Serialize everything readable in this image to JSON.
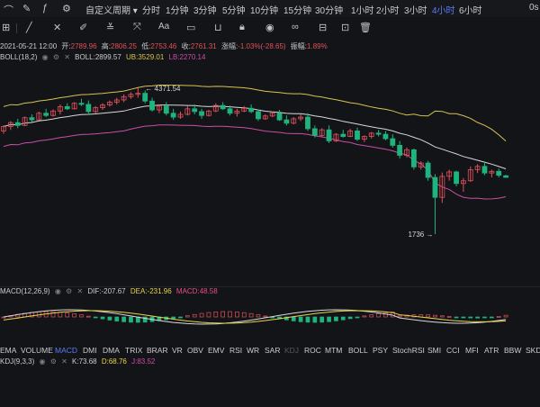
{
  "toolbar": {
    "intervals": [
      {
        "label": "自定义周期",
        "active": false,
        "dropdown": true
      },
      {
        "label": "分时",
        "active": false
      },
      {
        "label": "1分钟",
        "active": false
      },
      {
        "label": "3分钟",
        "active": false
      },
      {
        "label": "5分钟",
        "active": false
      },
      {
        "label": "10分钟",
        "active": false
      },
      {
        "label": "15分钟",
        "active": false
      },
      {
        "label": "30分钟",
        "active": false
      },
      {
        "label": "1小时",
        "active": false
      },
      {
        "label": "2小时",
        "active": false
      },
      {
        "label": "3小时",
        "active": false
      },
      {
        "label": "4小时",
        "active": true
      },
      {
        "label": "6小时",
        "active": false
      }
    ],
    "right_label": "0s"
  },
  "drawing_tools": [
    "fib-icon",
    "line-icon",
    "cross-icon",
    "underline-icon",
    "measure-icon",
    "close-brush-icon",
    "font-size-icon",
    "ruler-icon",
    "magnet-icon",
    "lock-icon",
    "eye-icon",
    "lock-icon-2",
    "trash-icon"
  ],
  "ohlc": {
    "date": "2021-05-21 12:00",
    "open_label": "开:",
    "open": "2789.96",
    "high_label": "高:",
    "high": "2806.25",
    "low_label": "低:",
    "low": "2753.46",
    "close_label": "收:",
    "close": "2761.31",
    "change_label": "涨幅:",
    "change": "-1.03%(-28.65)",
    "amp_label": "振幅:",
    "amp": "1.89%"
  },
  "boll": {
    "name": "BOLL(18,2)",
    "mid_label": "BOLL:",
    "mid": "2899.57",
    "ub_label": "UB:",
    "ub": "3529.01",
    "lb_label": "LB:",
    "lb": "2270.14"
  },
  "macd": {
    "name": "MACD(12,26,9)",
    "dif_label": "DIF:",
    "dif": "-207.67",
    "dea_label": "DEA:",
    "dea": "-231.96",
    "macd_label": "MACD:",
    "macd": "48.58"
  },
  "kdj": {
    "name": "KDJ(9,3,3)",
    "k_label": "K:",
    "k": "73.68",
    "d_label": "D:",
    "d": "68.76",
    "j_label": "J:",
    "j": "83.52"
  },
  "annotations": {
    "high": "4371.54",
    "low": "1736"
  },
  "indicators": [
    {
      "label": "EMA",
      "active": false
    },
    {
      "label": "VOLUME",
      "active": false
    },
    {
      "label": "MACD",
      "active": true
    },
    {
      "label": "DMI",
      "active": false
    },
    {
      "label": "DMA",
      "active": false
    },
    {
      "label": "TRIX",
      "active": false
    },
    {
      "label": "BRAR",
      "active": false
    },
    {
      "label": "VR",
      "active": false
    },
    {
      "label": "OBV",
      "active": false
    },
    {
      "label": "EMV",
      "active": false
    },
    {
      "label": "RSI",
      "active": false
    },
    {
      "label": "WR",
      "active": false
    },
    {
      "label": "SAR",
      "active": false
    },
    {
      "label": "KDJ",
      "active": false,
      "dim": true
    },
    {
      "label": "ROC",
      "active": false
    },
    {
      "label": "MTM",
      "active": false
    },
    {
      "label": "BOLL",
      "active": false
    },
    {
      "label": "PSY",
      "active": false
    },
    {
      "label": "StochRSI",
      "active": false
    },
    {
      "label": "SMI",
      "active": false
    },
    {
      "label": "CCI",
      "active": false
    },
    {
      "label": "MFI",
      "active": false
    },
    {
      "label": "ATR",
      "active": false
    },
    {
      "label": "BBW",
      "active": false
    },
    {
      "label": "SKD",
      "active": false
    }
  ],
  "colors": {
    "up": "#e0525c",
    "down": "#1fb47d",
    "boll_mid": "#d8d8d8",
    "boll_ub": "#d8c250",
    "boll_lb": "#c84fa6",
    "active": "#5b7cf6",
    "dea": "#e8d44d",
    "macd": "#e74e8a",
    "j": "#c84fa6"
  },
  "chart_data": {
    "type": "candlestick",
    "interval": "4小时",
    "candles": [
      [
        3600,
        3700,
        3550,
        3680
      ],
      [
        3680,
        3780,
        3620,
        3750
      ],
      [
        3750,
        3820,
        3650,
        3700
      ],
      [
        3700,
        3860,
        3690,
        3840
      ],
      [
        3840,
        3900,
        3760,
        3800
      ],
      [
        3800,
        3950,
        3790,
        3920
      ],
      [
        3920,
        4000,
        3850,
        3880
      ],
      [
        3880,
        3990,
        3860,
        3960
      ],
      [
        3960,
        4080,
        3900,
        4040
      ],
      [
        4040,
        4100,
        3980,
        4000
      ],
      [
        4000,
        4120,
        3990,
        4100
      ],
      [
        4100,
        4180,
        4050,
        4080
      ],
      [
        4080,
        4150,
        3900,
        3950
      ],
      [
        3950,
        4050,
        3920,
        4020
      ],
      [
        4020,
        4100,
        3980,
        4070
      ],
      [
        4070,
        4150,
        4040,
        4120
      ],
      [
        4120,
        4200,
        4080,
        4160
      ],
      [
        4160,
        4260,
        4120,
        4220
      ],
      [
        4220,
        4300,
        4180,
        4260
      ],
      [
        4260,
        4371.54,
        4200,
        4280
      ],
      [
        4280,
        4330,
        4100,
        4140
      ],
      [
        4140,
        4200,
        3950,
        3980
      ],
      [
        3980,
        4080,
        3920,
        4050
      ],
      [
        4050,
        4120,
        3880,
        3920
      ],
      [
        3920,
        4000,
        3800,
        3850
      ],
      [
        3850,
        3950,
        3820,
        3900
      ],
      [
        3900,
        4050,
        3880,
        4000
      ],
      [
        4000,
        4080,
        3900,
        3950
      ],
      [
        3950,
        4000,
        3820,
        3880
      ],
      [
        3880,
        3980,
        3860,
        3960
      ],
      [
        3960,
        4100,
        3940,
        4060
      ],
      [
        4060,
        4120,
        3980,
        4000
      ],
      [
        4000,
        4060,
        3880,
        3920
      ],
      [
        3920,
        4000,
        3860,
        3960
      ],
      [
        3960,
        4050,
        3940,
        4010
      ],
      [
        4010,
        4080,
        3920,
        3950
      ],
      [
        3950,
        3990,
        3780,
        3820
      ],
      [
        3820,
        3900,
        3800,
        3870
      ],
      [
        3870,
        3950,
        3850,
        3920
      ],
      [
        3920,
        3980,
        3780,
        3800
      ],
      [
        3800,
        3880,
        3700,
        3740
      ],
      [
        3740,
        3850,
        3720,
        3820
      ],
      [
        3820,
        3900,
        3780,
        3850
      ],
      [
        3850,
        3920,
        3600,
        3640
      ],
      [
        3640,
        3700,
        3480,
        3520
      ],
      [
        3520,
        3650,
        3500,
        3620
      ],
      [
        3620,
        3700,
        3380,
        3420
      ],
      [
        3420,
        3560,
        3400,
        3540
      ],
      [
        3540,
        3620,
        3480,
        3500
      ],
      [
        3500,
        3640,
        3490,
        3600
      ],
      [
        3600,
        3660,
        3420,
        3450
      ],
      [
        3450,
        3520,
        3400,
        3500
      ],
      [
        3500,
        3580,
        3460,
        3560
      ],
      [
        3560,
        3620,
        3500,
        3540
      ],
      [
        3540,
        3600,
        3430,
        3460
      ],
      [
        3460,
        3540,
        3300,
        3340
      ],
      [
        3340,
        3420,
        3100,
        3160
      ],
      [
        3160,
        3300,
        3120,
        3260
      ],
      [
        3260,
        3280,
        2900,
        2950
      ],
      [
        2950,
        3050,
        2900,
        3020
      ],
      [
        3020,
        3060,
        2700,
        2760
      ],
      [
        2760,
        2820,
        1736,
        2400
      ],
      [
        2400,
        2850,
        2300,
        2780
      ],
      [
        2780,
        2900,
        2700,
        2860
      ],
      [
        2860,
        2880,
        2600,
        2650
      ],
      [
        2650,
        2750,
        2500,
        2700
      ],
      [
        2700,
        2960,
        2680,
        2900
      ],
      [
        2900,
        3000,
        2840,
        2960
      ],
      [
        2960,
        3050,
        2800,
        2840
      ],
      [
        2840,
        2900,
        2760,
        2870
      ],
      [
        2870,
        2920,
        2760,
        2800
      ],
      [
        2789.96,
        2806.25,
        2753.46,
        2761.31
      ]
    ],
    "bollinger": {
      "mid": 2899.57,
      "upper": 3529.01,
      "lower": 2270.14
    }
  }
}
